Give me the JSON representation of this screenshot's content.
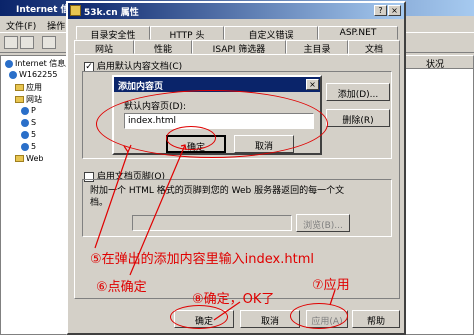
{
  "bg_window": {
    "title": "Internet 信息服务",
    "menu": [
      "文件(F)",
      "操作",
      "查看"
    ],
    "tree": [
      {
        "label": "Internet 信息服务"
      },
      {
        "label": "W162255"
      },
      {
        "label": "应用"
      },
      {
        "label": "网站"
      },
      {
        "label": "P"
      },
      {
        "label": "S"
      },
      {
        "label": "5"
      },
      {
        "label": "5"
      },
      {
        "label": "Web"
      }
    ],
    "right_column_header": "状况"
  },
  "prop_dialog": {
    "title": "53k.cn 属性",
    "help_btn": "?",
    "close_btn": "×",
    "tabs_back": [
      "目录安全性",
      "HTTP 头",
      "自定义错误",
      "ASP.NET"
    ],
    "tabs_front": [
      "网站",
      "性能",
      "ISAPI 筛选器",
      "主目录",
      "文档"
    ],
    "enable_default_doc": "启用默认内容文档(C)",
    "side_btn_1": "添加(D)...",
    "side_btn_2": "删除(R)",
    "enable_footer": "启用文档页脚(O)",
    "footer_desc": "附加一个 HTML 格式的页脚到您的 Web 服务器返回的每一个文档。",
    "browse_btn": "浏览(B)...",
    "ok": "确定",
    "cancel": "取消",
    "apply": "应用(A)",
    "help": "帮助"
  },
  "add_dialog": {
    "title": "添加内容页",
    "label": "默认内容页(D):",
    "value": "index.html",
    "ok": "确定",
    "cancel": "取消"
  },
  "annotations": {
    "step5": "⑤在弹出的添加内容里输入index.html",
    "step6": "⑥点确定",
    "step7": "⑦应用",
    "step8": "⑧确定，OK了"
  },
  "colors": {
    "annotation": "#e00000",
    "titlebar": "#0a246a",
    "dialog_bg": "#d4d0c8"
  }
}
